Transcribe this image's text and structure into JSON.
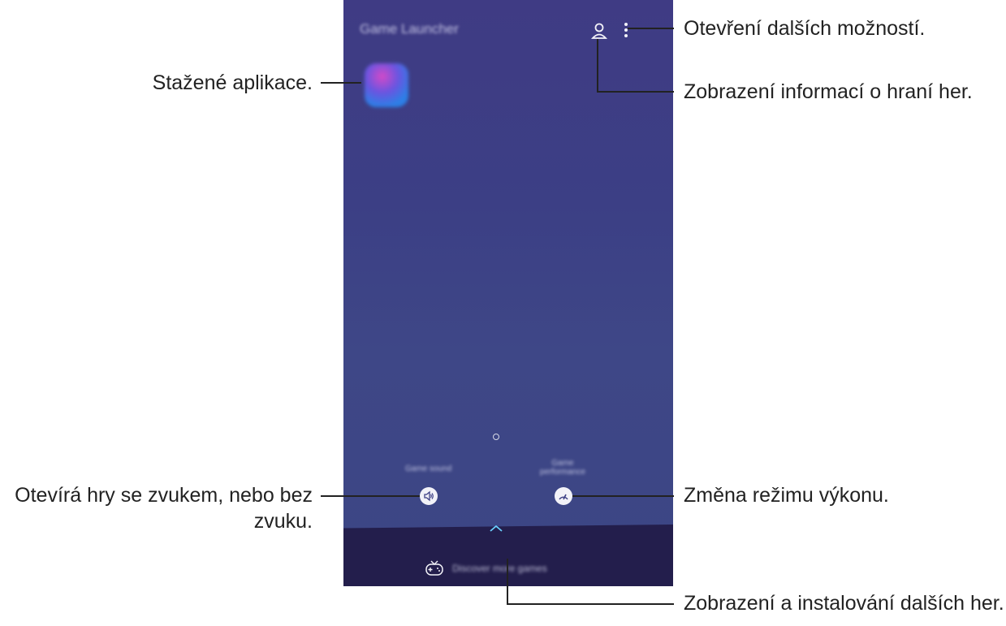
{
  "phone": {
    "title": "Game Launcher",
    "app_name": "",
    "sound_label": "Game sound",
    "performance_label": "Game performance",
    "discover_label": "Discover more games"
  },
  "callouts": {
    "more_options": "Otevření dalších možností.",
    "game_info": "Zobrazení informací o hraní her.",
    "downloaded_apps": "Stažené aplikace.",
    "sound_line1": "Otevírá hry se zvukem, nebo bez",
    "sound_line2": "zvuku.",
    "performance": "Změna režimu výkonu.",
    "discover": "Zobrazení a instalování dalších her."
  },
  "colors": {
    "background_top": "#3f3b84",
    "background_bottom": "#3c4584",
    "bottom_bar": "#231e4c",
    "accent": "#6ad0ff"
  },
  "icons": [
    "profile-icon",
    "more-options-icon",
    "sound-icon",
    "performance-icon",
    "chevron-up-icon",
    "gamepad-icon"
  ]
}
